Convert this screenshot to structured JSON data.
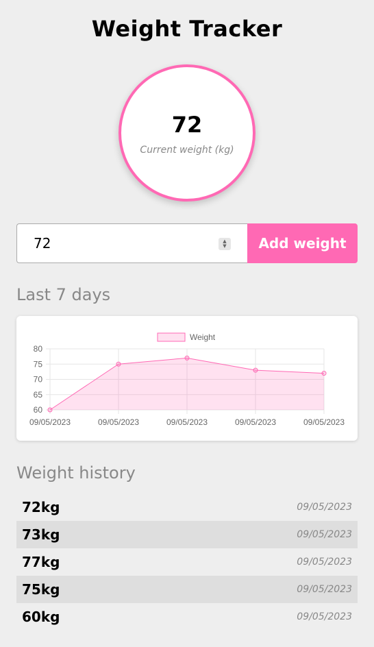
{
  "app": {
    "title": "Weight Tracker"
  },
  "current": {
    "value": "72",
    "label": "Current weight (kg)"
  },
  "form": {
    "input_value": "72",
    "add_button_label": "Add weight"
  },
  "sections": {
    "chart_title": "Last 7 days",
    "history_title": "Weight history"
  },
  "colors": {
    "accent": "#ff69b4",
    "background": "#eeeeee",
    "fill": "rgba(255,105,180,0.2)"
  },
  "chart_data": {
    "type": "line",
    "categories": [
      "09/05/2023",
      "09/05/2023",
      "09/05/2023",
      "09/05/2023",
      "09/05/2023"
    ],
    "series": [
      {
        "name": "Weight",
        "values": [
          60,
          75,
          77,
          73,
          72
        ]
      }
    ],
    "ylim": [
      60,
      80
    ],
    "yticks": [
      60,
      65,
      70,
      75,
      80
    ],
    "fill": true,
    "grid": true,
    "legend": "top"
  },
  "history": [
    {
      "weight": "72kg",
      "date": "09/05/2023"
    },
    {
      "weight": "73kg",
      "date": "09/05/2023"
    },
    {
      "weight": "77kg",
      "date": "09/05/2023"
    },
    {
      "weight": "75kg",
      "date": "09/05/2023"
    },
    {
      "weight": "60kg",
      "date": "09/05/2023"
    }
  ]
}
